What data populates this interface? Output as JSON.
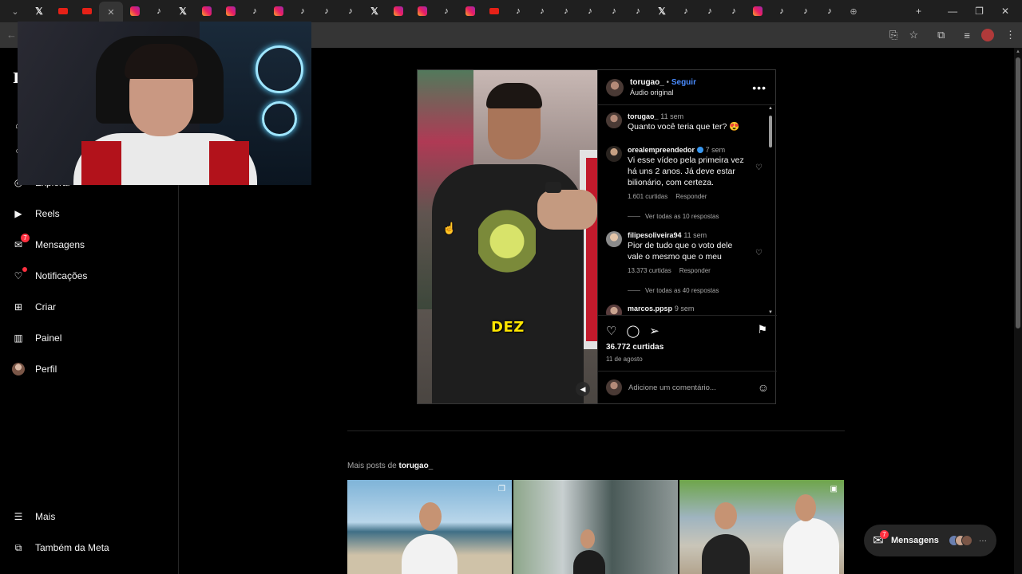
{
  "browser": {
    "tabs": [
      {
        "icon": "chevron-down-icon",
        "glyph": "⌄"
      },
      {
        "icon": "x-icon",
        "glyph": "𝕏"
      },
      {
        "icon": "youtube-icon",
        "glyph": ""
      },
      {
        "icon": "youtube-icon",
        "glyph": ""
      },
      {
        "icon": "close-icon",
        "glyph": "✕",
        "active": true
      },
      {
        "icon": "instagram-icon",
        "glyph": ""
      },
      {
        "icon": "tiktok-icon",
        "glyph": "♪"
      },
      {
        "icon": "x-icon",
        "glyph": "𝕏"
      },
      {
        "icon": "instagram-icon",
        "glyph": ""
      },
      {
        "icon": "instagram-icon",
        "glyph": ""
      },
      {
        "icon": "tiktok-icon",
        "glyph": "♪"
      },
      {
        "icon": "instagram-icon",
        "glyph": ""
      },
      {
        "icon": "tiktok-icon",
        "glyph": "♪"
      },
      {
        "icon": "tiktok-icon",
        "glyph": "♪"
      },
      {
        "icon": "tiktok-icon",
        "glyph": "♪"
      },
      {
        "icon": "x-icon",
        "glyph": "𝕏"
      },
      {
        "icon": "instagram-icon",
        "glyph": ""
      },
      {
        "icon": "instagram-icon",
        "glyph": ""
      },
      {
        "icon": "tiktok-icon",
        "glyph": "♪"
      },
      {
        "icon": "instagram-icon",
        "glyph": ""
      },
      {
        "icon": "youtube-icon",
        "glyph": ""
      },
      {
        "icon": "tiktok-icon",
        "glyph": "♪"
      },
      {
        "icon": "tiktok-icon",
        "glyph": "♪"
      },
      {
        "icon": "tiktok-icon",
        "glyph": "♪"
      },
      {
        "icon": "tiktok-icon",
        "glyph": "♪"
      },
      {
        "icon": "tiktok-icon",
        "glyph": "♪"
      },
      {
        "icon": "tiktok-icon",
        "glyph": "♪"
      },
      {
        "icon": "x-icon",
        "glyph": "𝕏"
      },
      {
        "icon": "tiktok-icon",
        "glyph": "♪"
      },
      {
        "icon": "tiktok-icon",
        "glyph": "♪"
      },
      {
        "icon": "tiktok-icon",
        "glyph": "♪"
      },
      {
        "icon": "instagram-icon",
        "glyph": ""
      },
      {
        "icon": "tiktok-icon",
        "glyph": "♪"
      },
      {
        "icon": "tiktok-icon",
        "glyph": "♪"
      },
      {
        "icon": "tiktok-icon",
        "glyph": "♪"
      },
      {
        "icon": "generic-tab-icon",
        "glyph": "⊕"
      }
    ],
    "new_tab": "+",
    "minimize": "—",
    "restore": "❐",
    "close": "✕",
    "toolbar_icons": [
      "install-app-icon",
      "star-icon",
      "extensions-icon",
      "media-controls-icon",
      "profile-icon",
      "menu-icon"
    ]
  },
  "sidebar": {
    "logo": "I",
    "items": [
      {
        "id": "explorar",
        "label": "Explorar",
        "icon": "compass-icon",
        "glyph": "◎"
      },
      {
        "id": "reels",
        "label": "Reels",
        "icon": "reels-icon",
        "glyph": "▶"
      },
      {
        "id": "mensagens",
        "label": "Mensagens",
        "icon": "messenger-icon",
        "glyph": "✉",
        "badge": "7"
      },
      {
        "id": "notificacoes",
        "label": "Notificações",
        "icon": "heart-icon",
        "glyph": "♡",
        "dot": true
      },
      {
        "id": "criar",
        "label": "Criar",
        "icon": "plus-square-icon",
        "glyph": "⊞"
      },
      {
        "id": "painel",
        "label": "Painel",
        "icon": "dashboard-icon",
        "glyph": "▥"
      },
      {
        "id": "perfil",
        "label": "Perfil",
        "icon": "avatar-icon",
        "glyph": ""
      }
    ],
    "bottom": [
      {
        "id": "mais",
        "label": "Mais",
        "icon": "hamburger-icon",
        "glyph": "☰"
      },
      {
        "id": "meta",
        "label": "Também da Meta",
        "icon": "meta-apps-icon",
        "glyph": "⧉"
      }
    ]
  },
  "post": {
    "header": {
      "username": "torugao_",
      "separator": " • ",
      "follow": "Seguir",
      "audio": "Áudio original",
      "more": "•••"
    },
    "caption_overlay": "DEZ",
    "sound_icon": "speaker-icon",
    "comments": [
      {
        "user": "torugao_",
        "time": "11 sem",
        "text": "Quanto você teria que ter? 😍",
        "verified": false
      },
      {
        "user": "orealempreendedor",
        "time": "7 sem",
        "text": "Vi esse vídeo pela primeira vez há uns 2 anos. Já deve estar bilionário, com certeza.",
        "likes": "1.601 curtidas",
        "reply": "Responder",
        "replies": "Ver todas as 10 respostas",
        "verified": true
      },
      {
        "user": "filipesoliveira94",
        "time": "11 sem",
        "text": "Pior de tudo que o voto dele vale o mesmo que o meu",
        "likes": "13.373 curtidas",
        "reply": "Responder",
        "replies": "Ver todas as 40 respostas",
        "verified": false
      },
      {
        "user": "marcos.ppsp",
        "time": "9 sem",
        "text": "",
        "verified": false
      }
    ],
    "likes": "36.772 curtidas",
    "date": "11 de agosto",
    "add_comment_placeholder": "Adicione um comentário..."
  },
  "more_posts": {
    "prefix": "Mais posts de ",
    "username": "torugao_"
  },
  "messages_bar": {
    "label": "Mensagens",
    "badge": "7",
    "more": "···"
  },
  "colors": {
    "background": "#000000",
    "accent_blue": "#4a8cff",
    "badge_red": "#ff3040",
    "caption_yellow": "#ffe600",
    "border": "#262626"
  }
}
